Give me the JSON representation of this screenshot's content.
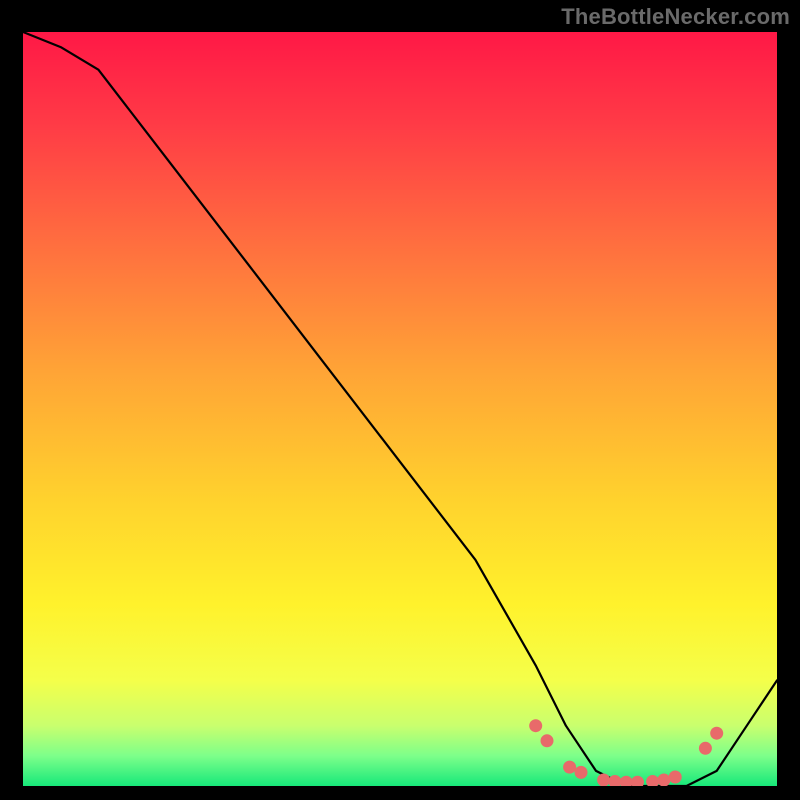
{
  "watermark": "TheBottleNecker.com",
  "chart_data": {
    "type": "line",
    "title": "",
    "xlabel": "",
    "ylabel": "",
    "xlim": [
      0,
      100
    ],
    "ylim": [
      0,
      100
    ],
    "series": [
      {
        "name": "bottleneck-curve",
        "x": [
          0,
          5,
          10,
          20,
          30,
          40,
          50,
          60,
          68,
          72,
          76,
          80,
          84,
          88,
          92,
          96,
          100
        ],
        "y": [
          100,
          98,
          95,
          82,
          69,
          56,
          43,
          30,
          16,
          8,
          2,
          0,
          0,
          0,
          2,
          8,
          14
        ]
      }
    ],
    "markers": {
      "name": "highlight-dots",
      "color": "#e86a6a",
      "points_x": [
        68.0,
        69.5,
        72.5,
        74.0,
        77.0,
        78.5,
        80.0,
        81.5,
        83.5,
        85.0,
        86.5,
        90.5,
        92.0
      ],
      "points_y": [
        8.0,
        6.0,
        2.5,
        1.8,
        0.8,
        0.6,
        0.5,
        0.5,
        0.6,
        0.8,
        1.2,
        5.0,
        7.0
      ]
    },
    "background_gradient": {
      "stops": [
        {
          "offset": 0.0,
          "color": "#ff1846"
        },
        {
          "offset": 0.12,
          "color": "#ff3a46"
        },
        {
          "offset": 0.28,
          "color": "#ff6e3f"
        },
        {
          "offset": 0.45,
          "color": "#ffa436"
        },
        {
          "offset": 0.62,
          "color": "#ffd22d"
        },
        {
          "offset": 0.76,
          "color": "#fff22c"
        },
        {
          "offset": 0.86,
          "color": "#f4ff4a"
        },
        {
          "offset": 0.92,
          "color": "#c9ff6e"
        },
        {
          "offset": 0.96,
          "color": "#7dff8a"
        },
        {
          "offset": 1.0,
          "color": "#17e87a"
        }
      ]
    }
  }
}
